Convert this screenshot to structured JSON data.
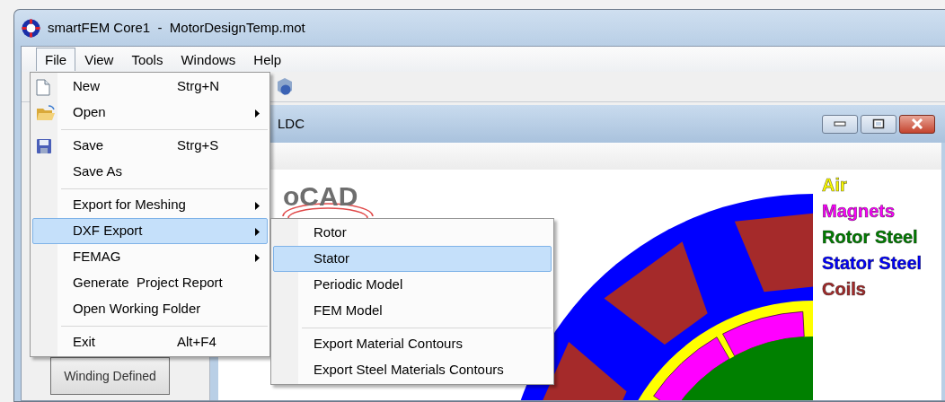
{
  "window": {
    "title": "smartFEM Core1  -  MotorDesignTemp.mot"
  },
  "menubar": [
    {
      "label": "File",
      "selected": true
    },
    {
      "label": "View",
      "selected": false
    },
    {
      "label": "Tools",
      "selected": false
    },
    {
      "label": "Windows",
      "selected": false
    },
    {
      "label": "Help",
      "selected": false
    }
  ],
  "file_menu": {
    "items": [
      {
        "kind": "item",
        "label": "New",
        "shortcut": "Strg+N",
        "submenu": false,
        "selected": false
      },
      {
        "kind": "item",
        "label": "Open",
        "submenu": true,
        "selected": false
      },
      {
        "kind": "separator"
      },
      {
        "kind": "item",
        "label": "Save",
        "shortcut": "Strg+S",
        "submenu": false,
        "selected": false
      },
      {
        "kind": "item",
        "label": "Save As",
        "submenu": false,
        "selected": false
      },
      {
        "kind": "separator"
      },
      {
        "kind": "item",
        "label": "Export for Meshing",
        "submenu": true,
        "selected": false
      },
      {
        "kind": "item",
        "label": "DXF Export",
        "submenu": true,
        "selected": true
      },
      {
        "kind": "item",
        "label": "FEMAG",
        "submenu": true,
        "selected": false
      },
      {
        "kind": "item",
        "label": "Generate  Project Report",
        "submenu": false,
        "selected": false
      },
      {
        "kind": "item",
        "label": "Open Working Folder",
        "submenu": false,
        "selected": false
      },
      {
        "kind": "separator"
      },
      {
        "kind": "item",
        "label": "Exit",
        "shortcut": "Alt+F4",
        "submenu": false,
        "selected": false
      }
    ]
  },
  "dxf_submenu": {
    "items": [
      {
        "kind": "item",
        "label": "Rotor",
        "selected": false
      },
      {
        "kind": "item",
        "label": "Stator",
        "selected": true
      },
      {
        "kind": "item",
        "label": "Periodic Model",
        "selected": false
      },
      {
        "kind": "item",
        "label": "FEM Model",
        "selected": false
      },
      {
        "kind": "separator"
      },
      {
        "kind": "item",
        "label": "Export Material Contours",
        "selected": false
      },
      {
        "kind": "item",
        "label": "Export Steel Materials Contours",
        "selected": false
      }
    ]
  },
  "child_window": {
    "title": "LDC",
    "logo_text": "oCAD"
  },
  "side_panel": {
    "button": "Winding Defined"
  },
  "legend": [
    {
      "label": "Air",
      "color": "#ffff00"
    },
    {
      "label": "Magnets",
      "color": "#ff00ff"
    },
    {
      "label": "Rotor Steel",
      "color": "#008000"
    },
    {
      "label": "Stator Steel",
      "color": "#0000ff"
    },
    {
      "label": "Coils",
      "color": "#a52a2a"
    }
  ]
}
